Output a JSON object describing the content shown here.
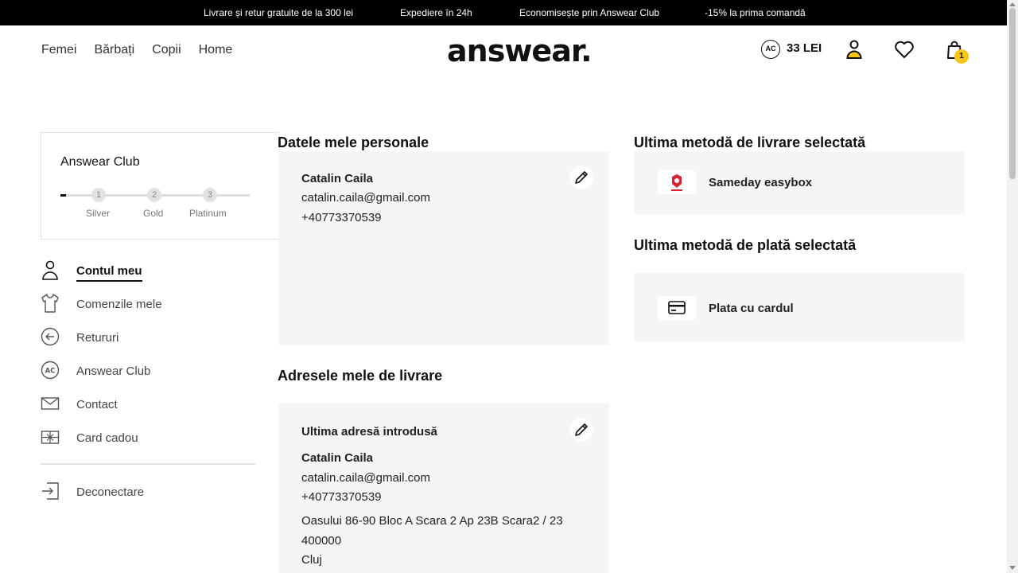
{
  "promo_bar": {
    "items": [
      "Livrare și retur gratuite de la 300 lei",
      "Expediere în 24h",
      "Economisește prin Answear Club",
      "-15% la prima comandă"
    ]
  },
  "header": {
    "nav": [
      "Femei",
      "Bărbați",
      "Copii",
      "Home"
    ],
    "logo": "answear.",
    "club_badge": "AC",
    "club_points": "33 LEI",
    "icons": [
      "user-icon",
      "heart-icon",
      "cart-icon"
    ],
    "cart_count": "1"
  },
  "club": {
    "title": "Answear Club",
    "progress_percent": 3,
    "levels": [
      {
        "number": "1",
        "name": "Silver"
      },
      {
        "number": "2",
        "name": "Gold"
      },
      {
        "number": "3",
        "name": "Platinum"
      }
    ]
  },
  "sidebar": {
    "items": [
      {
        "label": "Contul meu",
        "icon": "user-icon",
        "active": true
      },
      {
        "label": "Comenzile mele",
        "icon": "tshirt-icon",
        "active": false
      },
      {
        "label": "Retururi",
        "icon": "arrow-left-circle-icon",
        "active": false
      },
      {
        "label": "Answear Club",
        "icon": "ac-circle-icon",
        "active": false
      },
      {
        "label": "Contact",
        "icon": "envelope-icon",
        "active": false
      },
      {
        "label": "Card cadou",
        "icon": "gift-card-icon",
        "active": false
      }
    ],
    "logout": {
      "label": "Deconectare",
      "icon": "logout-icon"
    }
  },
  "personal": {
    "title": "Datele mele personale",
    "name": "Catalin Caila",
    "email": "catalin.caila@gmail.com",
    "phone": "+40773370539"
  },
  "addresses": {
    "title": "Adresele mele de livrare",
    "card_title": "Ultima adresă introdusă",
    "name": "Catalin Caila",
    "email": "catalin.caila@gmail.com",
    "phone": "+40773370539",
    "street": "Oasului 86-90 Bloc A Scara 2 Ap 23B Scara2 / 23",
    "postal": "400000",
    "city": "Cluj"
  },
  "delivery": {
    "title": "Ultima metodă de livrare selectată",
    "method": "Sameday easybox",
    "icon": "sameday-logo"
  },
  "payment": {
    "title": "Ultima metodă de plată selectată",
    "method": "Plata cu cardul",
    "icon": "credit-card-icon"
  },
  "colors": {
    "topbar": "#000000",
    "card_bg": "#f5f5f5",
    "cart_badge": "#f5c518",
    "sameday_red": "#d9232d"
  }
}
